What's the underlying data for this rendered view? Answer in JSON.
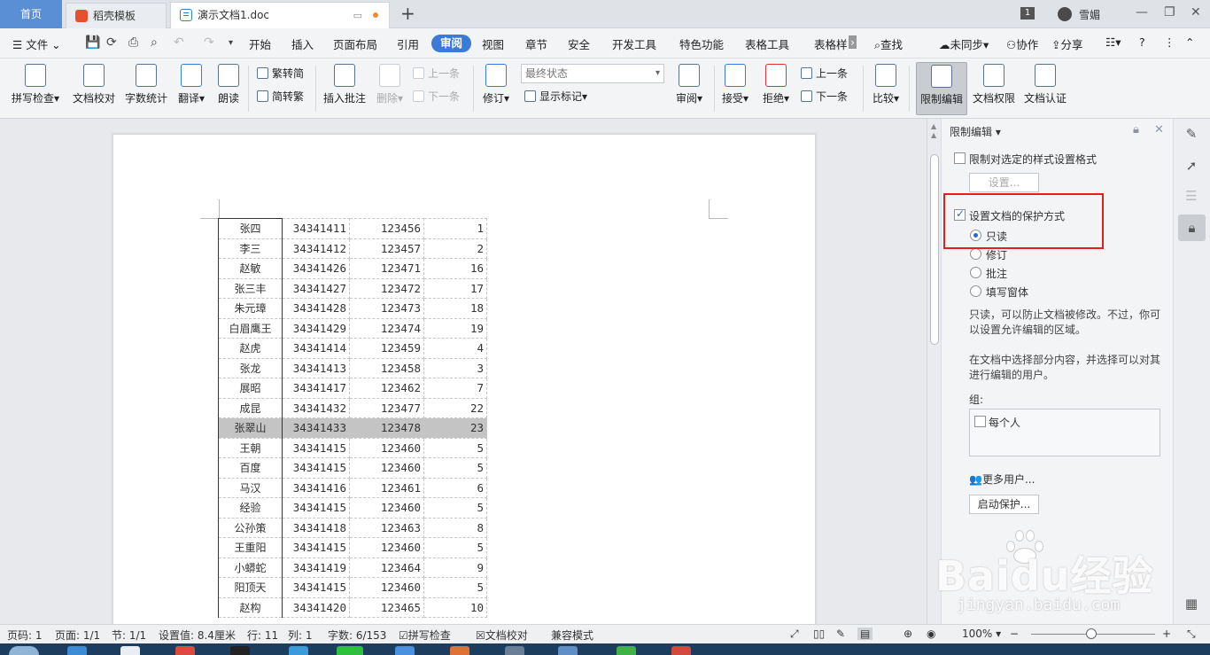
{
  "tabs": {
    "home": "首页",
    "shell": "稻壳模板",
    "doc": "演示文档1.doc",
    "badge": "1",
    "user": "雪媚"
  },
  "menu": {
    "file": "文件",
    "items": [
      "开始",
      "插入",
      "页面布局",
      "引用"
    ],
    "active": "审阅",
    "items2": [
      "视图",
      "章节",
      "安全",
      "开发工具",
      "特色功能",
      "表格工具",
      "表格样"
    ],
    "search": "查找",
    "sync": "未同步",
    "collab": "协作",
    "share": "分享"
  },
  "ribbon": {
    "spell": "拼写检查",
    "doccheck": "文档校对",
    "wordcount": "字数统计",
    "translate": "翻译",
    "read": "朗读",
    "trad": "繁转简",
    "simp": "简转繁",
    "comment": "插入批注",
    "delete": "删除",
    "prev": "上一条",
    "next": "下一条",
    "revise": "修订",
    "status": "最终状态",
    "markup": "显示标记",
    "review": "审阅",
    "accept": "接受",
    "reject": "拒绝",
    "prev2": "上一条",
    "next2": "下一条",
    "compare": "比较",
    "restrict": "限制编辑",
    "rights": "文档权限",
    "certify": "文档认证"
  },
  "table": [
    [
      "张四",
      "34341411",
      "123456",
      "1"
    ],
    [
      "李三",
      "34341412",
      "123457",
      "2"
    ],
    [
      "赵敏",
      "34341426",
      "123471",
      "16"
    ],
    [
      "张三丰",
      "34341427",
      "123472",
      "17"
    ],
    [
      "朱元璋",
      "34341428",
      "123473",
      "18"
    ],
    [
      "白眉鹰王",
      "34341429",
      "123474",
      "19"
    ],
    [
      "赵虎",
      "34341414",
      "123459",
      "4"
    ],
    [
      "张龙",
      "34341413",
      "123458",
      "3"
    ],
    [
      "展昭",
      "34341417",
      "123462",
      "7"
    ],
    [
      "成昆",
      "34341432",
      "123477",
      "22"
    ],
    [
      "张翠山",
      "34341433",
      "123478",
      "23"
    ],
    [
      "王朝",
      "34341415",
      "123460",
      "5"
    ],
    [
      "百度",
      "34341415",
      "123460",
      "5"
    ],
    [
      "马汉",
      "34341416",
      "123461",
      "6"
    ],
    [
      "经验",
      "34341415",
      "123460",
      "5"
    ],
    [
      "公孙策",
      "34341418",
      "123463",
      "8"
    ],
    [
      "王重阳",
      "34341415",
      "123460",
      "5"
    ],
    [
      "小蟒蛇",
      "34341419",
      "123464",
      "9"
    ],
    [
      "阳顶天",
      "34341415",
      "123460",
      "5"
    ],
    [
      "赵构",
      "34341420",
      "123465",
      "10"
    ]
  ],
  "panel": {
    "title": "限制编辑",
    "restrict_format": "限制对选定的样式设置格式",
    "settings": "设置...",
    "protect": "设置文档的保护方式",
    "opt_readonly": "只读",
    "opt_revise": "修订",
    "opt_comment": "批注",
    "opt_form": "填写窗体",
    "desc1": "只读，可以防止文档被修改。不过，你可以设置允许编辑的区域。",
    "desc2": "在文档中选择部分内容，并选择可以对其进行编辑的用户。",
    "group": "组:",
    "everyone": "每个人",
    "more_users": "更多用户...",
    "start": "启动保护..."
  },
  "status": {
    "page": "页码: 1",
    "pages": "页面: 1/1",
    "section": "节: 1/1",
    "setting": "设置值: 8.4厘米",
    "row": "行: 11",
    "col": "列: 1",
    "words": "字数: 6/153",
    "spell": "拼写检查",
    "doccheck": "文档校对",
    "compat": "兼容模式",
    "zoom": "100%"
  },
  "watermark": {
    "brand": "Baidu经验",
    "url": "jingyan.baidu.com"
  }
}
